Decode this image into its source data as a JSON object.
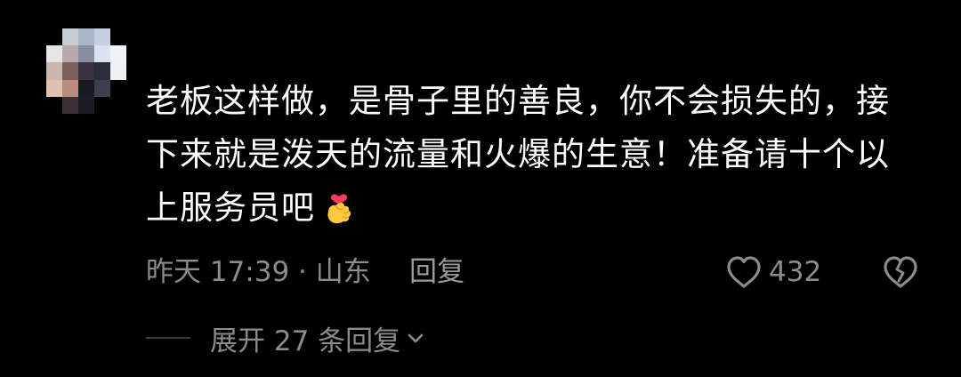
{
  "comment": {
    "lines": [
      "老板这样做，是骨子里的善良，你不会损失的，接",
      "下来就是泼天的流量和火爆的生意！准备请十个以",
      "上服务员吧"
    ],
    "emoji": "finger-heart-emoji",
    "time_location": "昨天 17:39 · 山东",
    "reply_label": "回复",
    "like_count": "432",
    "expand_label": "展开 27 条回复"
  },
  "icons": {
    "like": "heart-outline-icon",
    "dislike": "broken-heart-icon",
    "expand": "chevron-down-icon"
  },
  "colors": {
    "background": "#000000",
    "text": "#ffffff",
    "meta": "#8b8b8b",
    "divider": "#3a3a3a",
    "emoji_heart": "#ff3b5c",
    "emoji_hand": "#ffc83d"
  }
}
